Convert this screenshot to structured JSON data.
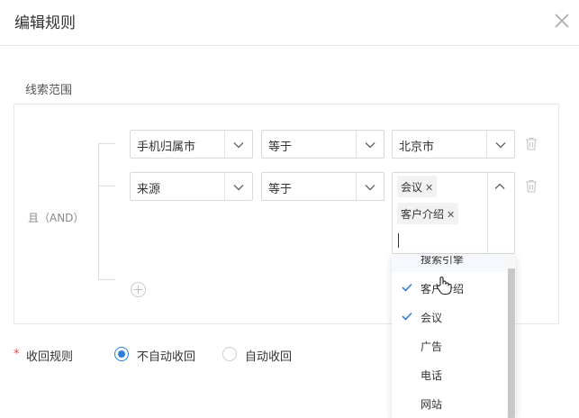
{
  "dialog": {
    "title": "编辑规则"
  },
  "section": {
    "label": "线索范围"
  },
  "logic": {
    "label": "且（AND）"
  },
  "rows": [
    {
      "field": "手机归属市",
      "operator": "等于",
      "value": "北京市"
    },
    {
      "field": "来源",
      "operator": "等于",
      "tags": [
        "会议",
        "客户介绍"
      ]
    }
  ],
  "recycle": {
    "required_mark": "*",
    "label": "收回规则",
    "options": [
      {
        "label": "不自动收回",
        "checked": true
      },
      {
        "label": "自动收回",
        "checked": false
      }
    ]
  },
  "dropdown": {
    "items": [
      {
        "label": "搜索引擎",
        "checked": false
      },
      {
        "label": "客户介绍",
        "checked": true
      },
      {
        "label": "会议",
        "checked": true
      },
      {
        "label": "广告",
        "checked": false
      },
      {
        "label": "电话",
        "checked": false
      },
      {
        "label": "网站",
        "checked": false
      }
    ]
  },
  "colors": {
    "accent": "#2d7fdb",
    "required": "#e04b4b"
  }
}
